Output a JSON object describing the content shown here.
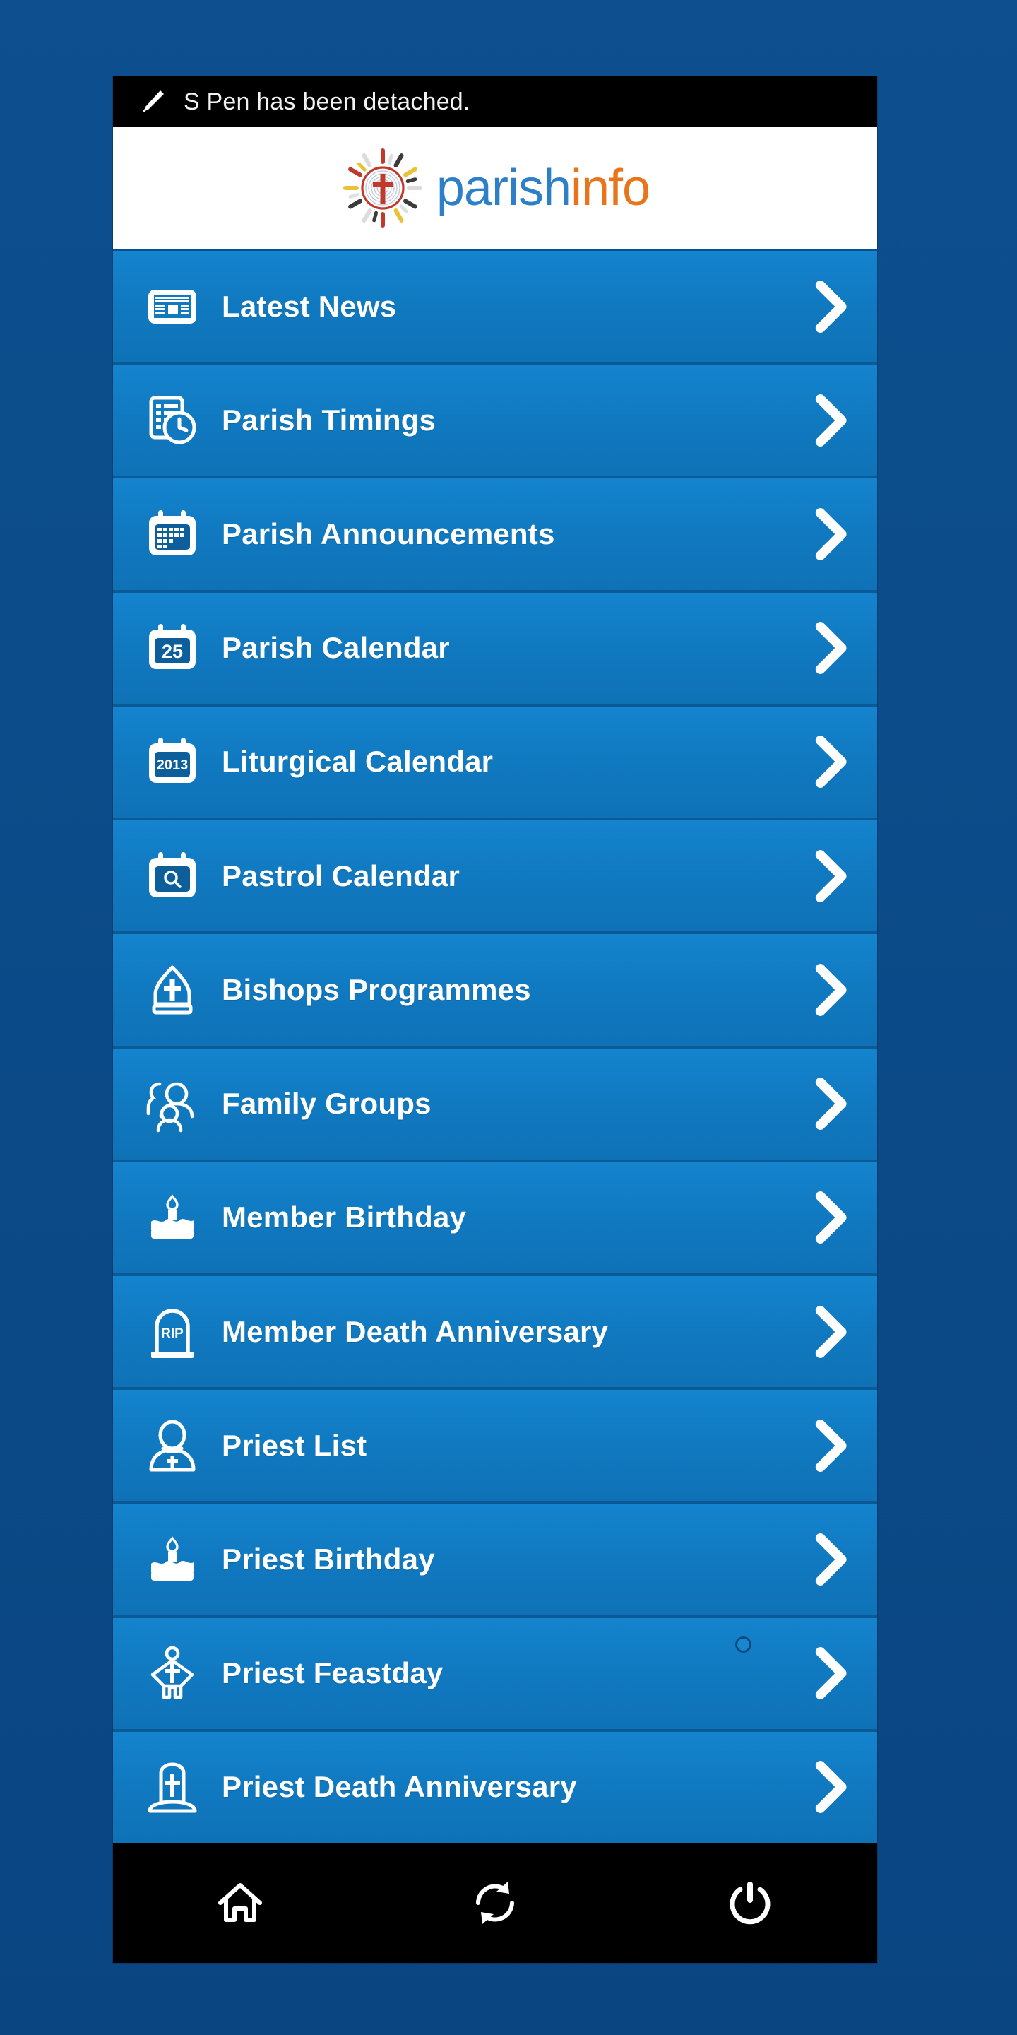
{
  "statusbar": {
    "icon": "s-pen-icon",
    "message": "S Pen has been detached."
  },
  "header": {
    "logo_icon": "parish-cross-logo-icon",
    "brand_first": "parish",
    "brand_second": "info",
    "brand_first_color": "#2d80c8",
    "brand_second_color": "#e8741c"
  },
  "menu": {
    "items": [
      {
        "label": "Latest News",
        "icon": "newspaper-icon"
      },
      {
        "label": "Parish Timings",
        "icon": "document-clock-icon"
      },
      {
        "label": "Parish Announcements",
        "icon": "calendar-grid-icon"
      },
      {
        "label": "Parish Calendar",
        "icon": "calendar-25-icon",
        "badge": "25"
      },
      {
        "label": "Liturgical Calendar",
        "icon": "calendar-2013-icon",
        "badge": "2013"
      },
      {
        "label": "Pastrol Calendar",
        "icon": "calendar-search-icon"
      },
      {
        "label": "Bishops Programmes",
        "icon": "mitre-cross-icon"
      },
      {
        "label": "Family Groups",
        "icon": "family-group-icon"
      },
      {
        "label": "Member Birthday",
        "icon": "birthday-cake-icon"
      },
      {
        "label": "Member Death Anniversary",
        "icon": "tombstone-rip-icon",
        "badge": "RIP"
      },
      {
        "label": "Priest List",
        "icon": "priest-person-icon"
      },
      {
        "label": "Priest Birthday",
        "icon": "birthday-cake-icon"
      },
      {
        "label": "Priest Feastday",
        "icon": "priest-vestment-cross-icon"
      },
      {
        "label": "Priest Death Anniversary",
        "icon": "gravestone-cross-icon"
      }
    ],
    "chevron_icon": "chevron-right-icon",
    "row_color": "#1079c0",
    "divider_color": "#0b5a96"
  },
  "bottombar": {
    "buttons": [
      {
        "name": "home",
        "icon": "home-icon"
      },
      {
        "name": "refresh",
        "icon": "refresh-icon"
      },
      {
        "name": "power",
        "icon": "power-icon"
      }
    ]
  }
}
